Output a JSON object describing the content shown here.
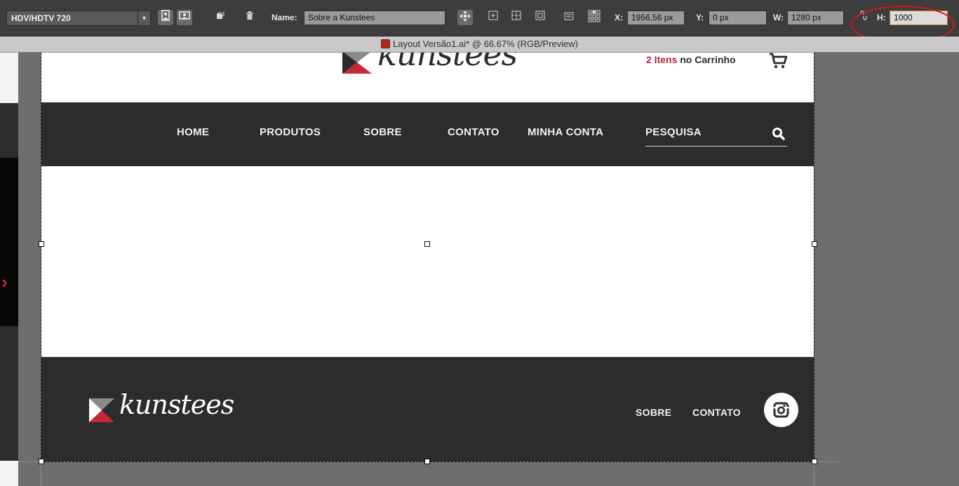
{
  "control_bar": {
    "preset": "HDV/HDTV 720",
    "name_label": "Name:",
    "name_value": "Sobre a Kunstees",
    "x_label": "X:",
    "x_value": "1956.56 px",
    "y_label": "Y:",
    "y_value": "0 px",
    "w_label": "W:",
    "w_value": "1280 px",
    "h_label": "H:",
    "h_value": "1000"
  },
  "document_tab": {
    "title": "Layout Versão1.ai* @ 66.67% (RGB/Preview)"
  },
  "site": {
    "brand": "kunstees",
    "cart_count": "2 Itens",
    "cart_text": "no Carrinho",
    "nav": [
      "HOME",
      "PRODUTOS",
      "SOBRE",
      "CONTATO",
      "MINHA CONTA",
      "PESQUISA"
    ],
    "footer_brand": "kunstees",
    "footer_nav": [
      "SOBRE",
      "CONTATO"
    ]
  },
  "colors": {
    "accent_red": "#c62735",
    "dark_band": "#2c2c2c",
    "callout_red": "#d81818"
  }
}
